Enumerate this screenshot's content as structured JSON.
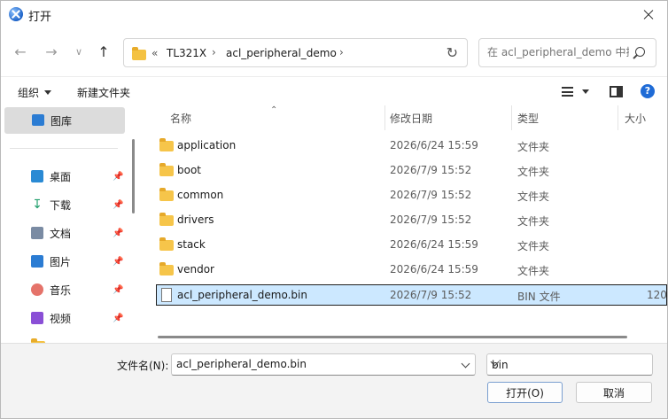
{
  "window": {
    "title": "打开"
  },
  "nav": {
    "breadcrumb": [
      "«",
      "TL321X",
      "acl_peripheral_demo"
    ],
    "search_placeholder": "在 acl_peripheral_demo 中搜索"
  },
  "toolbar": {
    "organize": "组织",
    "new_folder": "新建文件夹"
  },
  "sidebar": {
    "gallery": "图库",
    "items": [
      {
        "label": "桌面",
        "icon": "desktop-icon",
        "color": "#2a8ad4"
      },
      {
        "label": "下载",
        "icon": "download-icon",
        "color": "#1f9e6b"
      },
      {
        "label": "文档",
        "icon": "document-icon",
        "color": "#7a8ba3"
      },
      {
        "label": "图片",
        "icon": "pictures-icon",
        "color": "#2b7cd3"
      },
      {
        "label": "音乐",
        "icon": "music-icon",
        "color": "#e5736a"
      },
      {
        "label": "视频",
        "icon": "video-icon",
        "color": "#8a4fd6"
      }
    ]
  },
  "columns": {
    "name": "名称",
    "date": "修改日期",
    "type": "类型",
    "size": "大小"
  },
  "files": [
    {
      "name": "application",
      "date": "2026/6/24 15:59",
      "type": "文件夹",
      "size": "",
      "kind": "folder"
    },
    {
      "name": "boot",
      "date": "2026/7/9 15:52",
      "type": "文件夹",
      "size": "",
      "kind": "folder"
    },
    {
      "name": "common",
      "date": "2026/7/9 15:52",
      "type": "文件夹",
      "size": "",
      "kind": "folder"
    },
    {
      "name": "drivers",
      "date": "2026/7/9 15:52",
      "type": "文件夹",
      "size": "",
      "kind": "folder"
    },
    {
      "name": "stack",
      "date": "2026/6/24 15:59",
      "type": "文件夹",
      "size": "",
      "kind": "folder"
    },
    {
      "name": "vendor",
      "date": "2026/6/24 15:59",
      "type": "文件夹",
      "size": "",
      "kind": "folder"
    },
    {
      "name": "acl_peripheral_demo.bin",
      "date": "2026/7/9 15:52",
      "type": "BIN 文件",
      "size": "120",
      "kind": "file",
      "selected": true
    }
  ],
  "footer": {
    "filename_label": "文件名(N):",
    "filename_value": "acl_peripheral_demo.bin",
    "filetype": "bin",
    "open_label": "打开(O)",
    "cancel_label": "取消"
  }
}
